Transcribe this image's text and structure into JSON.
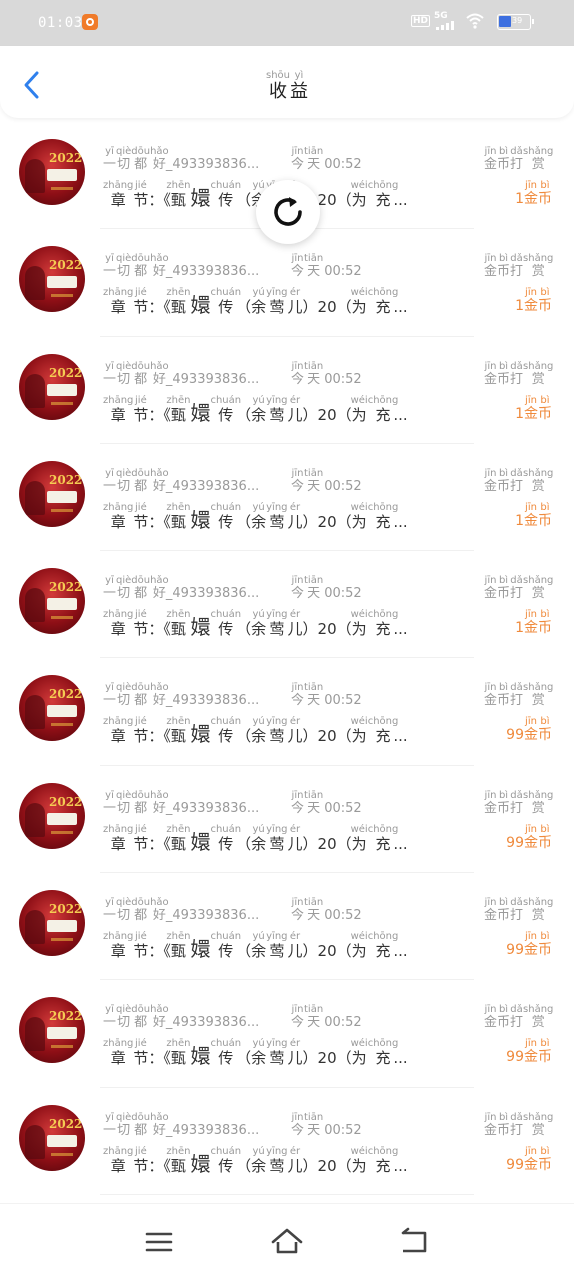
{
  "status_bar": {
    "time": "01:03",
    "network_label": "5G",
    "hd_label": "HD",
    "battery_level": "39"
  },
  "header": {
    "title": [
      {
        "char": "收",
        "pinyin": "shōu"
      },
      {
        "char": "益",
        "pinyin": "yì"
      }
    ]
  },
  "items": [
    {
      "username": "一切都好_493393836...",
      "username_pinyin": [
        [
          "一",
          "yī"
        ],
        [
          "切",
          "qiè"
        ],
        [
          "都",
          "dōu"
        ],
        [
          "好",
          "hǎo"
        ]
      ],
      "user_suffix": "_493393836...",
      "time_prefix": [
        [
          "今",
          "jīn"
        ],
        [
          "天",
          "tiān"
        ]
      ],
      "time": "00:52",
      "chapter_prefix": [
        [
          "章",
          "zhāng"
        ],
        [
          "节",
          "jié"
        ]
      ],
      "book": [
        [
          "甄",
          "zhēn"
        ],
        [
          "嬛",
          ""
        ],
        [
          "传",
          "chuán"
        ]
      ],
      "character": [
        [
          "余",
          "yú"
        ],
        [
          "莺",
          "yīng"
        ],
        [
          "儿",
          "ér"
        ]
      ],
      "chapter_num": "20",
      "action": [
        [
          "为",
          "wéi"
        ],
        [
          "充",
          "chōng"
        ]
      ],
      "ellipsis": "...",
      "reward_label": [
        [
          "金",
          "jīn"
        ],
        [
          "币",
          "bì"
        ],
        [
          "打",
          "dǎ"
        ],
        [
          "赏",
          "shǎng"
        ]
      ],
      "amount": "1",
      "unit": [
        [
          "金",
          "jīn"
        ],
        [
          "币",
          "bì"
        ]
      ]
    },
    {
      "username": "一切都好_493393836...",
      "username_pinyin": [
        [
          "一",
          "yī"
        ],
        [
          "切",
          "qiè"
        ],
        [
          "都",
          "dōu"
        ],
        [
          "好",
          "hǎo"
        ]
      ],
      "user_suffix": "_493393836...",
      "time_prefix": [
        [
          "今",
          "jīn"
        ],
        [
          "天",
          "tiān"
        ]
      ],
      "time": "00:52",
      "chapter_prefix": [
        [
          "章",
          "zhāng"
        ],
        [
          "节",
          "jié"
        ]
      ],
      "book": [
        [
          "甄",
          "zhēn"
        ],
        [
          "嬛",
          ""
        ],
        [
          "传",
          "chuán"
        ]
      ],
      "character": [
        [
          "余",
          "yú"
        ],
        [
          "莺",
          "yīng"
        ],
        [
          "儿",
          "ér"
        ]
      ],
      "chapter_num": "20",
      "action": [
        [
          "为",
          "wéi"
        ],
        [
          "充",
          "chōng"
        ]
      ],
      "ellipsis": "...",
      "reward_label": [
        [
          "金",
          "jīn"
        ],
        [
          "币",
          "bì"
        ],
        [
          "打",
          "dǎ"
        ],
        [
          "赏",
          "shǎng"
        ]
      ],
      "amount": "1",
      "unit": [
        [
          "金",
          "jīn"
        ],
        [
          "币",
          "bì"
        ]
      ]
    },
    {
      "username": "一切都好_493393836...",
      "username_pinyin": [
        [
          "一",
          "yī"
        ],
        [
          "切",
          "qiè"
        ],
        [
          "都",
          "dōu"
        ],
        [
          "好",
          "hǎo"
        ]
      ],
      "user_suffix": "_493393836...",
      "time_prefix": [
        [
          "今",
          "jīn"
        ],
        [
          "天",
          "tiān"
        ]
      ],
      "time": "00:52",
      "chapter_prefix": [
        [
          "章",
          "zhāng"
        ],
        [
          "节",
          "jié"
        ]
      ],
      "book": [
        [
          "甄",
          "zhēn"
        ],
        [
          "嬛",
          ""
        ],
        [
          "传",
          "chuán"
        ]
      ],
      "character": [
        [
          "余",
          "yú"
        ],
        [
          "莺",
          "yīng"
        ],
        [
          "儿",
          "ér"
        ]
      ],
      "chapter_num": "20",
      "action": [
        [
          "为",
          "wéi"
        ],
        [
          "充",
          "chōng"
        ]
      ],
      "ellipsis": "...",
      "reward_label": [
        [
          "金",
          "jīn"
        ],
        [
          "币",
          "bì"
        ],
        [
          "打",
          "dǎ"
        ],
        [
          "赏",
          "shǎng"
        ]
      ],
      "amount": "1",
      "unit": [
        [
          "金",
          "jīn"
        ],
        [
          "币",
          "bì"
        ]
      ]
    },
    {
      "username": "一切都好_493393836...",
      "username_pinyin": [
        [
          "一",
          "yī"
        ],
        [
          "切",
          "qiè"
        ],
        [
          "都",
          "dōu"
        ],
        [
          "好",
          "hǎo"
        ]
      ],
      "user_suffix": "_493393836...",
      "time_prefix": [
        [
          "今",
          "jīn"
        ],
        [
          "天",
          "tiān"
        ]
      ],
      "time": "00:52",
      "chapter_prefix": [
        [
          "章",
          "zhāng"
        ],
        [
          "节",
          "jié"
        ]
      ],
      "book": [
        [
          "甄",
          "zhēn"
        ],
        [
          "嬛",
          ""
        ],
        [
          "传",
          "chuán"
        ]
      ],
      "character": [
        [
          "余",
          "yú"
        ],
        [
          "莺",
          "yīng"
        ],
        [
          "儿",
          "ér"
        ]
      ],
      "chapter_num": "20",
      "action": [
        [
          "为",
          "wéi"
        ],
        [
          "充",
          "chōng"
        ]
      ],
      "ellipsis": "...",
      "reward_label": [
        [
          "金",
          "jīn"
        ],
        [
          "币",
          "bì"
        ],
        [
          "打",
          "dǎ"
        ],
        [
          "赏",
          "shǎng"
        ]
      ],
      "amount": "1",
      "unit": [
        [
          "金",
          "jīn"
        ],
        [
          "币",
          "bì"
        ]
      ]
    },
    {
      "username": "一切都好_493393836...",
      "username_pinyin": [
        [
          "一",
          "yī"
        ],
        [
          "切",
          "qiè"
        ],
        [
          "都",
          "dōu"
        ],
        [
          "好",
          "hǎo"
        ]
      ],
      "user_suffix": "_493393836...",
      "time_prefix": [
        [
          "今",
          "jīn"
        ],
        [
          "天",
          "tiān"
        ]
      ],
      "time": "00:52",
      "chapter_prefix": [
        [
          "章",
          "zhāng"
        ],
        [
          "节",
          "jié"
        ]
      ],
      "book": [
        [
          "甄",
          "zhēn"
        ],
        [
          "嬛",
          ""
        ],
        [
          "传",
          "chuán"
        ]
      ],
      "character": [
        [
          "余",
          "yú"
        ],
        [
          "莺",
          "yīng"
        ],
        [
          "儿",
          "ér"
        ]
      ],
      "chapter_num": "20",
      "action": [
        [
          "为",
          "wéi"
        ],
        [
          "充",
          "chōng"
        ]
      ],
      "ellipsis": "...",
      "reward_label": [
        [
          "金",
          "jīn"
        ],
        [
          "币",
          "bì"
        ],
        [
          "打",
          "dǎ"
        ],
        [
          "赏",
          "shǎng"
        ]
      ],
      "amount": "1",
      "unit": [
        [
          "金",
          "jīn"
        ],
        [
          "币",
          "bì"
        ]
      ]
    },
    {
      "username": "一切都好_493393836...",
      "username_pinyin": [
        [
          "一",
          "yī"
        ],
        [
          "切",
          "qiè"
        ],
        [
          "都",
          "dōu"
        ],
        [
          "好",
          "hǎo"
        ]
      ],
      "user_suffix": "_493393836...",
      "time_prefix": [
        [
          "今",
          "jīn"
        ],
        [
          "天",
          "tiān"
        ]
      ],
      "time": "00:52",
      "chapter_prefix": [
        [
          "章",
          "zhāng"
        ],
        [
          "节",
          "jié"
        ]
      ],
      "book": [
        [
          "甄",
          "zhēn"
        ],
        [
          "嬛",
          ""
        ],
        [
          "传",
          "chuán"
        ]
      ],
      "character": [
        [
          "余",
          "yú"
        ],
        [
          "莺",
          "yīng"
        ],
        [
          "儿",
          "ér"
        ]
      ],
      "chapter_num": "20",
      "action": [
        [
          "为",
          "wéi"
        ],
        [
          "充",
          "chōng"
        ]
      ],
      "ellipsis": "...",
      "reward_label": [
        [
          "金",
          "jīn"
        ],
        [
          "币",
          "bì"
        ],
        [
          "打",
          "dǎ"
        ],
        [
          "赏",
          "shǎng"
        ]
      ],
      "amount": "99",
      "unit": [
        [
          "金",
          "jīn"
        ],
        [
          "币",
          "bì"
        ]
      ]
    },
    {
      "username": "一切都好_493393836...",
      "username_pinyin": [
        [
          "一",
          "yī"
        ],
        [
          "切",
          "qiè"
        ],
        [
          "都",
          "dōu"
        ],
        [
          "好",
          "hǎo"
        ]
      ],
      "user_suffix": "_493393836...",
      "time_prefix": [
        [
          "今",
          "jīn"
        ],
        [
          "天",
          "tiān"
        ]
      ],
      "time": "00:52",
      "chapter_prefix": [
        [
          "章",
          "zhāng"
        ],
        [
          "节",
          "jié"
        ]
      ],
      "book": [
        [
          "甄",
          "zhēn"
        ],
        [
          "嬛",
          ""
        ],
        [
          "传",
          "chuán"
        ]
      ],
      "character": [
        [
          "余",
          "yú"
        ],
        [
          "莺",
          "yīng"
        ],
        [
          "儿",
          "ér"
        ]
      ],
      "chapter_num": "20",
      "action": [
        [
          "为",
          "wéi"
        ],
        [
          "充",
          "chōng"
        ]
      ],
      "ellipsis": "...",
      "reward_label": [
        [
          "金",
          "jīn"
        ],
        [
          "币",
          "bì"
        ],
        [
          "打",
          "dǎ"
        ],
        [
          "赏",
          "shǎng"
        ]
      ],
      "amount": "99",
      "unit": [
        [
          "金",
          "jīn"
        ],
        [
          "币",
          "bì"
        ]
      ]
    },
    {
      "username": "一切都好_493393836...",
      "username_pinyin": [
        [
          "一",
          "yī"
        ],
        [
          "切",
          "qiè"
        ],
        [
          "都",
          "dōu"
        ],
        [
          "好",
          "hǎo"
        ]
      ],
      "user_suffix": "_493393836...",
      "time_prefix": [
        [
          "今",
          "jīn"
        ],
        [
          "天",
          "tiān"
        ]
      ],
      "time": "00:52",
      "chapter_prefix": [
        [
          "章",
          "zhāng"
        ],
        [
          "节",
          "jié"
        ]
      ],
      "book": [
        [
          "甄",
          "zhēn"
        ],
        [
          "嬛",
          ""
        ],
        [
          "传",
          "chuán"
        ]
      ],
      "character": [
        [
          "余",
          "yú"
        ],
        [
          "莺",
          "yīng"
        ],
        [
          "儿",
          "ér"
        ]
      ],
      "chapter_num": "20",
      "action": [
        [
          "为",
          "wéi"
        ],
        [
          "充",
          "chōng"
        ]
      ],
      "ellipsis": "...",
      "reward_label": [
        [
          "金",
          "jīn"
        ],
        [
          "币",
          "bì"
        ],
        [
          "打",
          "dǎ"
        ],
        [
          "赏",
          "shǎng"
        ]
      ],
      "amount": "99",
      "unit": [
        [
          "金",
          "jīn"
        ],
        [
          "币",
          "bì"
        ]
      ]
    },
    {
      "username": "一切都好_493393836...",
      "username_pinyin": [
        [
          "一",
          "yī"
        ],
        [
          "切",
          "qiè"
        ],
        [
          "都",
          "dōu"
        ],
        [
          "好",
          "hǎo"
        ]
      ],
      "user_suffix": "_493393836...",
      "time_prefix": [
        [
          "今",
          "jīn"
        ],
        [
          "天",
          "tiān"
        ]
      ],
      "time": "00:52",
      "chapter_prefix": [
        [
          "章",
          "zhāng"
        ],
        [
          "节",
          "jié"
        ]
      ],
      "book": [
        [
          "甄",
          "zhēn"
        ],
        [
          "嬛",
          ""
        ],
        [
          "传",
          "chuán"
        ]
      ],
      "character": [
        [
          "余",
          "yú"
        ],
        [
          "莺",
          "yīng"
        ],
        [
          "儿",
          "ér"
        ]
      ],
      "chapter_num": "20",
      "action": [
        [
          "为",
          "wéi"
        ],
        [
          "充",
          "chōng"
        ]
      ],
      "ellipsis": "...",
      "reward_label": [
        [
          "金",
          "jīn"
        ],
        [
          "币",
          "bì"
        ],
        [
          "打",
          "dǎ"
        ],
        [
          "赏",
          "shǎng"
        ]
      ],
      "amount": "99",
      "unit": [
        [
          "金",
          "jīn"
        ],
        [
          "币",
          "bì"
        ]
      ]
    },
    {
      "username": "一切都好_493393836...",
      "username_pinyin": [
        [
          "一",
          "yī"
        ],
        [
          "切",
          "qiè"
        ],
        [
          "都",
          "dōu"
        ],
        [
          "好",
          "hǎo"
        ]
      ],
      "user_suffix": "_493393836...",
      "time_prefix": [
        [
          "今",
          "jīn"
        ],
        [
          "天",
          "tiān"
        ]
      ],
      "time": "00:52",
      "chapter_prefix": [
        [
          "章",
          "zhāng"
        ],
        [
          "节",
          "jié"
        ]
      ],
      "book": [
        [
          "甄",
          "zhēn"
        ],
        [
          "嬛",
          ""
        ],
        [
          "传",
          "chuán"
        ]
      ],
      "character": [
        [
          "余",
          "yú"
        ],
        [
          "莺",
          "yīng"
        ],
        [
          "儿",
          "ér"
        ]
      ],
      "chapter_num": "20",
      "action": [
        [
          "为",
          "wéi"
        ],
        [
          "充",
          "chōng"
        ]
      ],
      "ellipsis": "...",
      "reward_label": [
        [
          "金",
          "jīn"
        ],
        [
          "币",
          "bì"
        ],
        [
          "打",
          "dǎ"
        ],
        [
          "赏",
          "shǎng"
        ]
      ],
      "amount": "99",
      "unit": [
        [
          "金",
          "jīn"
        ],
        [
          "币",
          "bì"
        ]
      ]
    }
  ],
  "avatar_text": "2022",
  "colors": {
    "accent": "#2f80ed",
    "amount": "#ef8a3c",
    "status_bar": "#d9d9d9",
    "avatar_red": "#8e0f16"
  },
  "icons": {
    "back": "chevron-left-icon",
    "refresh": "refresh-icon",
    "nav_menu": "menu-icon",
    "nav_home": "home-icon",
    "nav_back": "back-icon"
  }
}
